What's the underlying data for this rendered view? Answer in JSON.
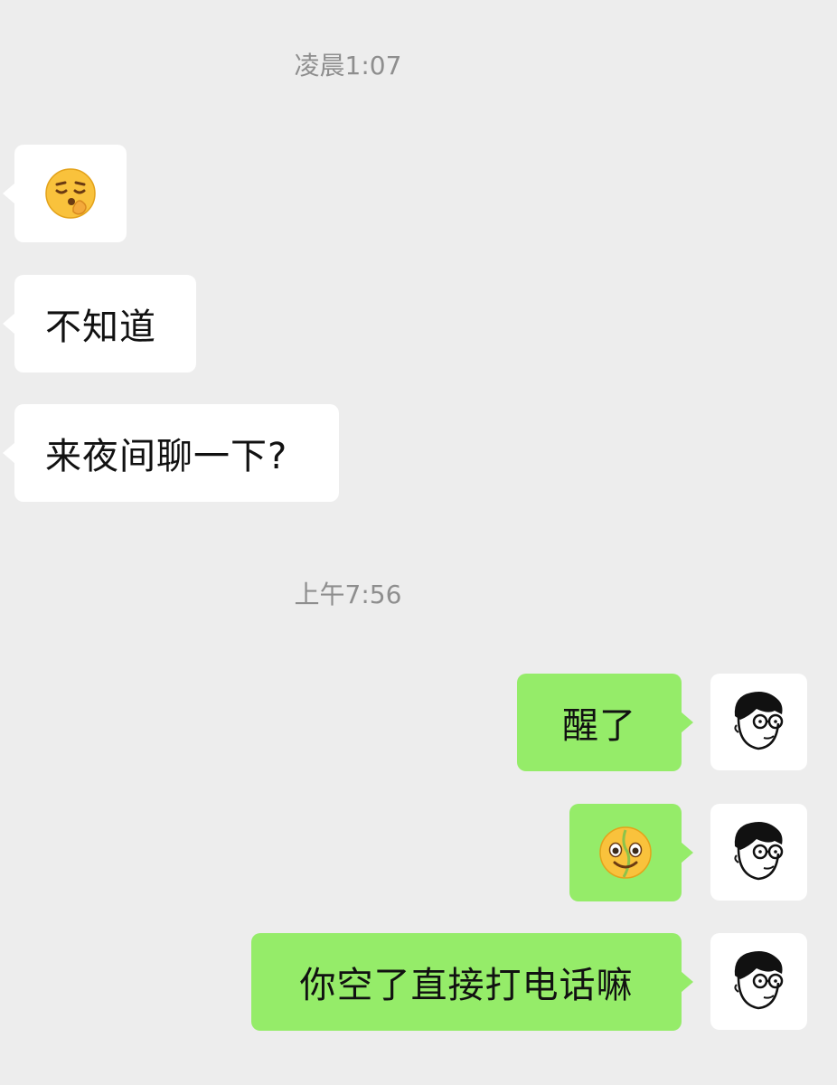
{
  "chat": {
    "timestamps": [
      "凌晨1:07",
      "上午7:56"
    ],
    "incoming": [
      {
        "type": "emoji",
        "icon": "shushing-face-emoji"
      },
      {
        "type": "text",
        "text": "不知道"
      },
      {
        "type": "text",
        "text": "来夜间聊一下?"
      }
    ],
    "outgoing": [
      {
        "type": "text",
        "text": "醒了"
      },
      {
        "type": "emoji",
        "icon": "melting-smile-emoji"
      },
      {
        "type": "text",
        "text": "你空了直接打电话嘛"
      }
    ],
    "own_avatar": {
      "icon": "man-with-glasses-avatar-icon"
    }
  },
  "colors": {
    "background": "#ededed",
    "incoming_bubble": "#ffffff",
    "outgoing_bubble": "#95ec69",
    "timestamp_text": "#8e8e8e"
  }
}
